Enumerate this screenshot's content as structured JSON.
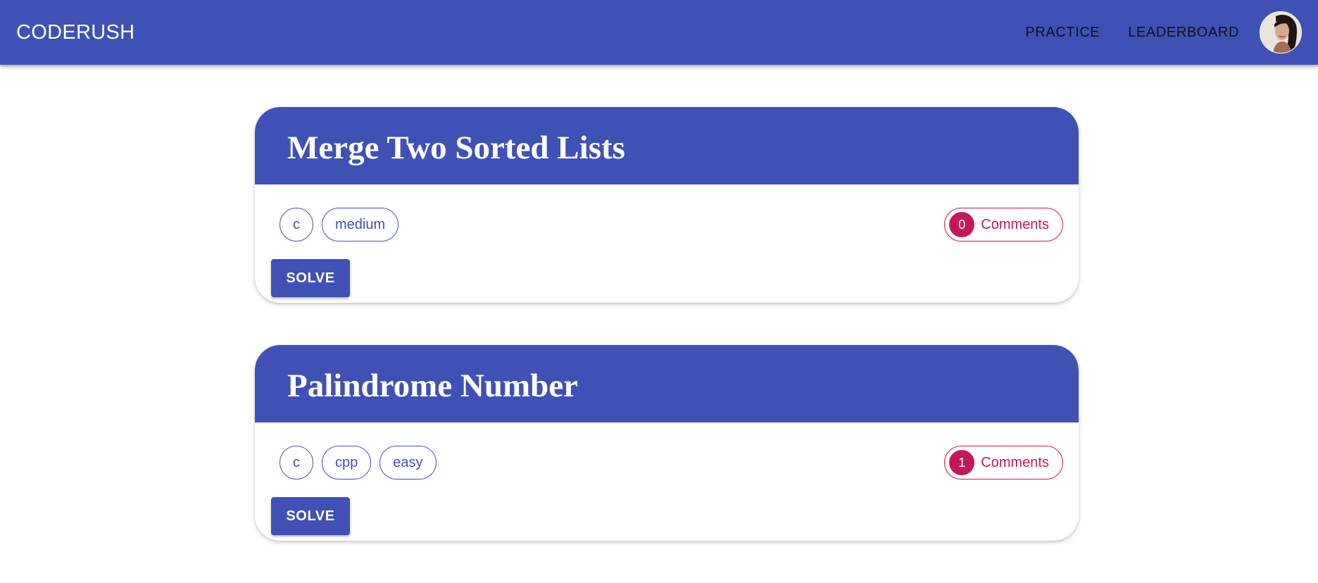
{
  "appbar": {
    "brand": "CODERUSH",
    "nav": [
      {
        "label": "PRACTICE"
      },
      {
        "label": "LEADERBOARD"
      }
    ]
  },
  "problems": [
    {
      "title": "Merge Two Sorted Lists",
      "tags": [
        "c",
        "medium"
      ],
      "comments_count": "0",
      "comments_label": "Comments",
      "solve_label": "SOLVE"
    },
    {
      "title": "Palindrome Number",
      "tags": [
        "c",
        "cpp",
        "easy"
      ],
      "comments_count": "1",
      "comments_label": "Comments",
      "solve_label": "SOLVE"
    }
  ],
  "colors": {
    "primary": "#3f51b5",
    "secondary": "#c2185b",
    "background": "#ffffff"
  },
  "icons": {
    "avatar": "user-avatar-photo"
  }
}
